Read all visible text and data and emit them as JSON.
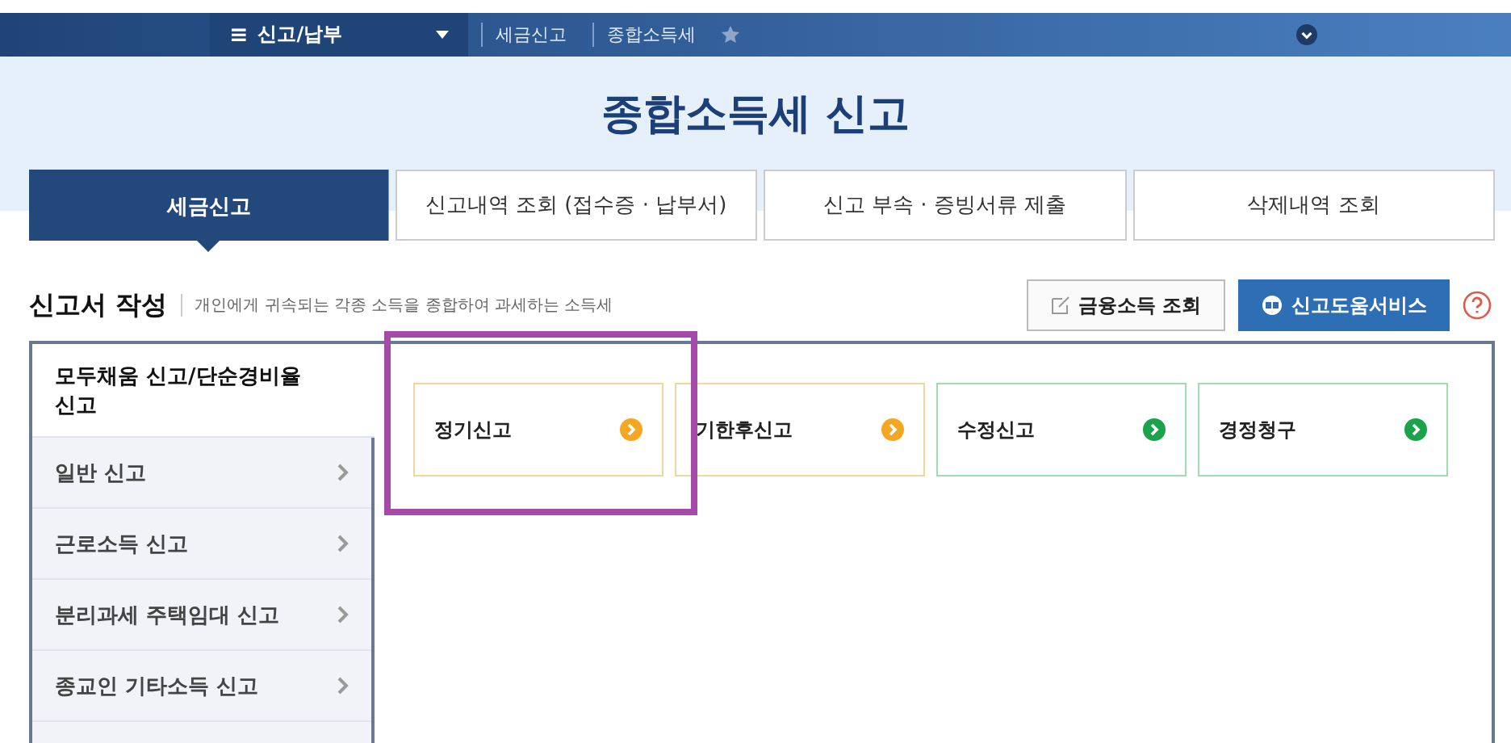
{
  "nav": {
    "menu_icon": "≡",
    "menu": "신고/납부",
    "breadcrumbs": [
      "세금신고",
      "종합소득세"
    ]
  },
  "title": "종합소득세 신고",
  "tabs": [
    {
      "label": "세금신고",
      "selected": true
    },
    {
      "label": "신고내역 조회 (접수증 · 납부서)",
      "selected": false
    },
    {
      "label": "신고 부속 · 증빙서류 제출",
      "selected": false
    },
    {
      "label": "삭제내역 조회",
      "selected": false
    }
  ],
  "section": {
    "title": "신고서 작성",
    "description": "개인에게 귀속되는 각종 소득을 종합하여 과세하는 소득세",
    "buttons": [
      {
        "kind": "plain",
        "label": "금융소득 조회"
      },
      {
        "kind": "primary",
        "label": "신고도움서비스"
      }
    ]
  },
  "sidebar": {
    "items": [
      {
        "label": "모두채움 신고/단순경비율 신고",
        "selected": true
      },
      {
        "label": "일반 신고",
        "selected": false
      },
      {
        "label": "근로소득 신고",
        "selected": false
      },
      {
        "label": "분리과세 주택임대 신고",
        "selected": false
      },
      {
        "label": "종교인 기타소득 신고",
        "selected": false
      }
    ]
  },
  "cards": [
    {
      "label": "정기신고",
      "color": "#f5a623"
    },
    {
      "label": "기한후신고",
      "color": "#f5a623"
    },
    {
      "label": "수정신고",
      "color": "#1aa34a"
    },
    {
      "label": "경정청구",
      "color": "#1aa34a"
    }
  ]
}
